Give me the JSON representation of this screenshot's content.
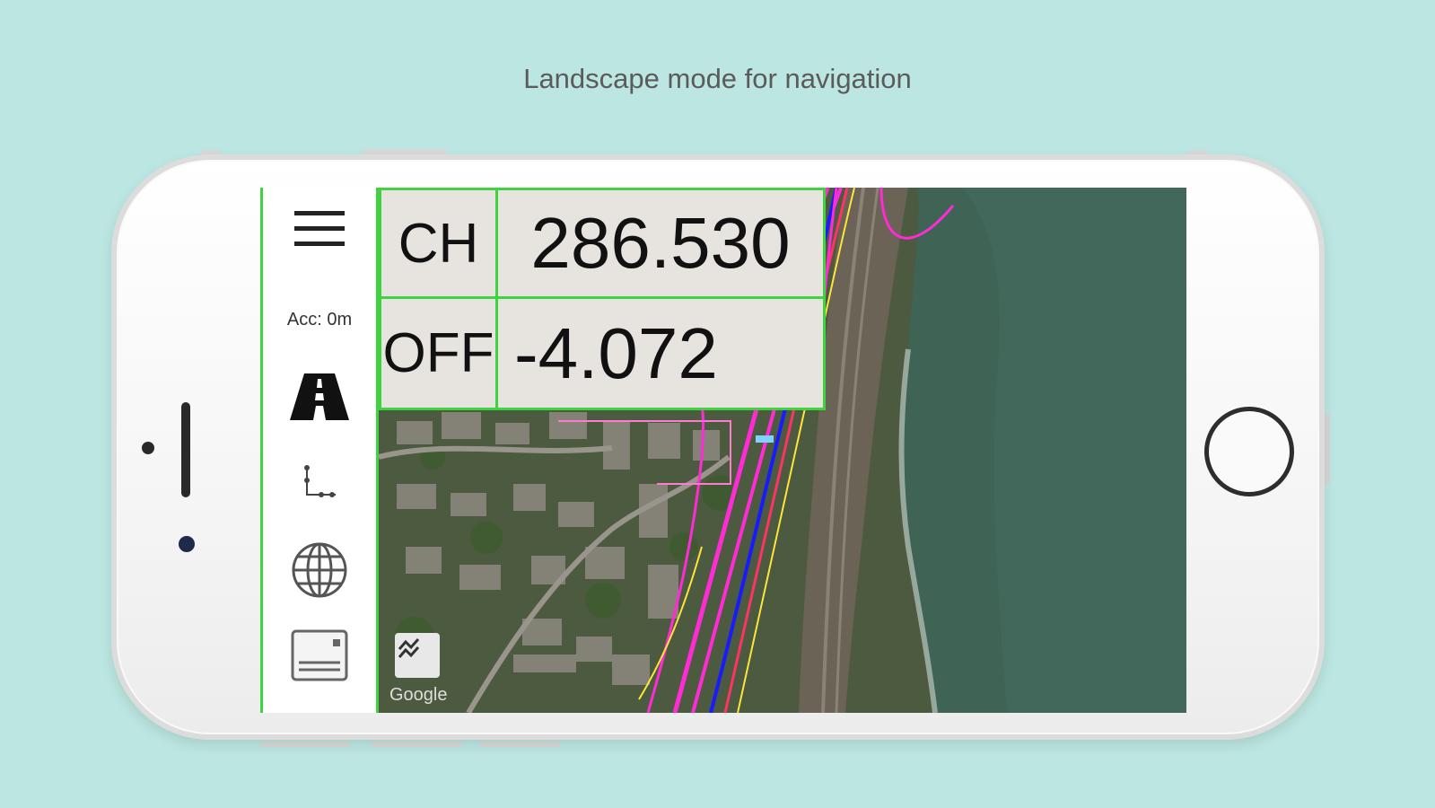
{
  "caption": "Landscape mode for navigation",
  "sidebar": {
    "menu_icon": "hamburger-menu-icon",
    "accuracy_label": "Acc: 0m",
    "road_icon": "road-icon",
    "coordinates_icon": "chainage-offset-icon",
    "globe_icon": "globe-icon",
    "keyboard_icon": "keyboard-card-icon"
  },
  "readout": {
    "rows": [
      {
        "label": "CH",
        "value": "286.530"
      },
      {
        "label": "OFF",
        "value": "-4.072"
      }
    ],
    "border_color": "#3fd33f"
  },
  "map": {
    "attribution": "Google",
    "layers_icon": "map-layers-icon",
    "locate_icon": "my-location-icon"
  },
  "colors": {
    "background": "#bce6e1",
    "accent_green": "#3fd33f",
    "readout_bg": "#e7e4df"
  }
}
